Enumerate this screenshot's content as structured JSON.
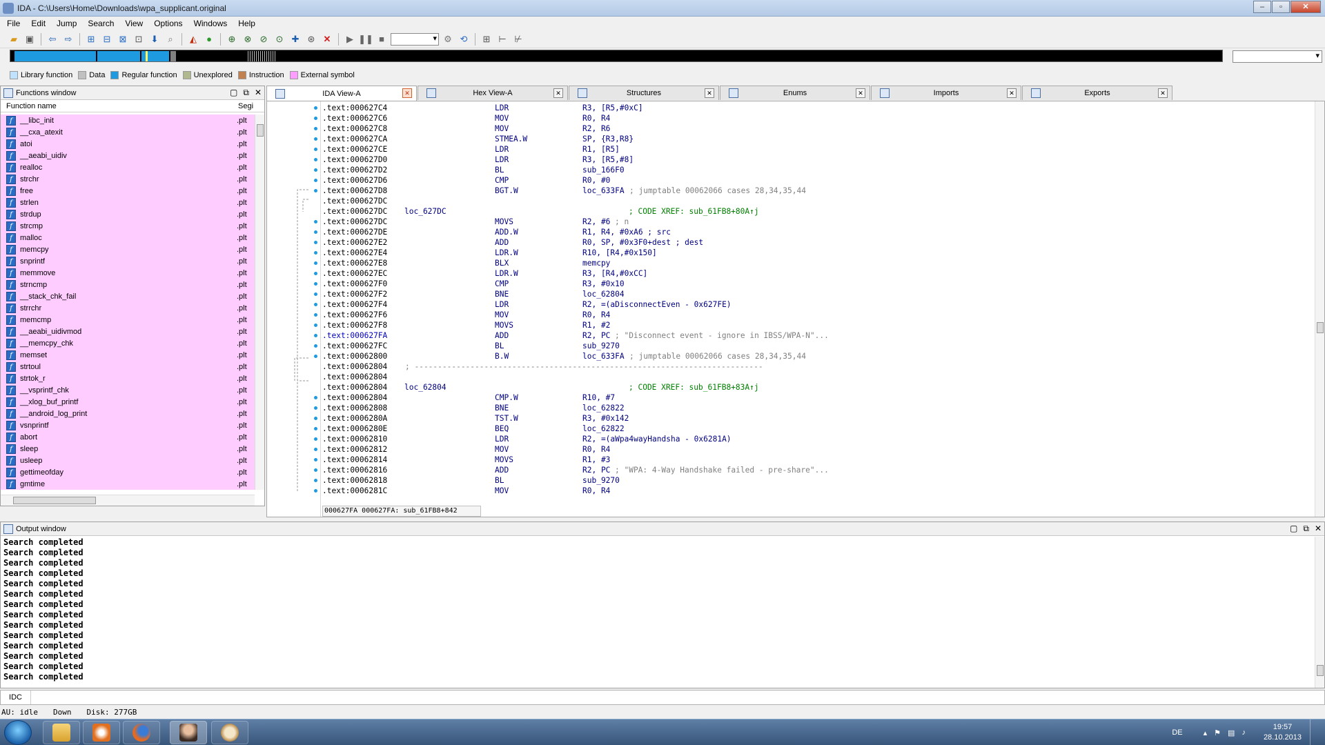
{
  "window": {
    "title": "IDA - C:\\Users\\Home\\Downloads\\wpa_supplicant.original"
  },
  "menu": [
    "File",
    "Edit",
    "Jump",
    "Search",
    "View",
    "Options",
    "Windows",
    "Help"
  ],
  "legend": [
    {
      "label": "Library function",
      "color": "#bfe3ff"
    },
    {
      "label": "Data",
      "color": "#c0c0c0"
    },
    {
      "label": "Regular function",
      "color": "#1e9be0"
    },
    {
      "label": "Unexplored",
      "color": "#b0b890"
    },
    {
      "label": "Instruction",
      "color": "#c08050"
    },
    {
      "label": "External symbol",
      "color": "#ff9cff"
    }
  ],
  "functions_window": {
    "title": "Functions window",
    "col_name": "Function name",
    "col_seg": "Segi",
    "items": [
      {
        "name": "__libc_init",
        "seg": ".plt"
      },
      {
        "name": "__cxa_atexit",
        "seg": ".plt"
      },
      {
        "name": "atoi",
        "seg": ".plt"
      },
      {
        "name": "__aeabi_uidiv",
        "seg": ".plt"
      },
      {
        "name": "realloc",
        "seg": ".plt"
      },
      {
        "name": "strchr",
        "seg": ".plt"
      },
      {
        "name": "free",
        "seg": ".plt"
      },
      {
        "name": "strlen",
        "seg": ".plt"
      },
      {
        "name": "strdup",
        "seg": ".plt"
      },
      {
        "name": "strcmp",
        "seg": ".plt"
      },
      {
        "name": "malloc",
        "seg": ".plt"
      },
      {
        "name": "memcpy",
        "seg": ".plt"
      },
      {
        "name": "snprintf",
        "seg": ".plt"
      },
      {
        "name": "memmove",
        "seg": ".plt"
      },
      {
        "name": "strncmp",
        "seg": ".plt"
      },
      {
        "name": "__stack_chk_fail",
        "seg": ".plt"
      },
      {
        "name": "strrchr",
        "seg": ".plt"
      },
      {
        "name": "memcmp",
        "seg": ".plt"
      },
      {
        "name": "__aeabi_uidivmod",
        "seg": ".plt"
      },
      {
        "name": "__memcpy_chk",
        "seg": ".plt"
      },
      {
        "name": "memset",
        "seg": ".plt"
      },
      {
        "name": "strtoul",
        "seg": ".plt"
      },
      {
        "name": "strtok_r",
        "seg": ".plt"
      },
      {
        "name": "__vsprintf_chk",
        "seg": ".plt"
      },
      {
        "name": "__xlog_buf_printf",
        "seg": ".plt"
      },
      {
        "name": "__android_log_print",
        "seg": ".plt"
      },
      {
        "name": "vsnprintf",
        "seg": ".plt"
      },
      {
        "name": "abort",
        "seg": ".plt"
      },
      {
        "name": "sleep",
        "seg": ".plt"
      },
      {
        "name": "usleep",
        "seg": ".plt"
      },
      {
        "name": "gettimeofday",
        "seg": ".plt"
      },
      {
        "name": "gmtime",
        "seg": ".plt"
      }
    ]
  },
  "tabs": [
    {
      "label": "IDA View-A",
      "active": true
    },
    {
      "label": "Hex View-A",
      "active": false
    },
    {
      "label": "Structures",
      "active": false
    },
    {
      "label": "Enums",
      "active": false
    },
    {
      "label": "Imports",
      "active": false
    },
    {
      "label": "Exports",
      "active": false
    }
  ],
  "disasm": {
    "lines": [
      {
        "addr": ".text:000627C4",
        "lbl": "",
        "mn": "LDR",
        "op": "R3, [R5,#0xC]",
        "cm": "",
        "xr": "",
        "dot": true
      },
      {
        "addr": ".text:000627C6",
        "lbl": "",
        "mn": "MOV",
        "op": "R0, R4",
        "cm": "",
        "xr": "",
        "dot": true
      },
      {
        "addr": ".text:000627C8",
        "lbl": "",
        "mn": "MOV",
        "op": "R2, R6",
        "cm": "",
        "xr": "",
        "dot": true
      },
      {
        "addr": ".text:000627CA",
        "lbl": "",
        "mn": "STMEA.W",
        "op": "SP, {R3,R8}",
        "cm": "",
        "xr": "",
        "dot": true
      },
      {
        "addr": ".text:000627CE",
        "lbl": "",
        "mn": "LDR",
        "op": "R1, [R5]",
        "cm": "",
        "xr": "",
        "dot": true
      },
      {
        "addr": ".text:000627D0",
        "lbl": "",
        "mn": "LDR",
        "op": "R3, [R5,#8]",
        "cm": "",
        "xr": "",
        "dot": true
      },
      {
        "addr": ".text:000627D2",
        "lbl": "",
        "mn": "BL",
        "op": "sub_166F0",
        "cm": "",
        "xr": "",
        "dot": true
      },
      {
        "addr": ".text:000627D6",
        "lbl": "",
        "mn": "CMP",
        "op": "R0, #0",
        "cm": "",
        "xr": "",
        "dot": true
      },
      {
        "addr": ".text:000627D8",
        "lbl": "",
        "mn": "BGT.W",
        "op": "loc_633FA",
        "cm": "; jumptable 00062066 cases 28,34,35,44",
        "xr": "",
        "dot": true
      },
      {
        "addr": ".text:000627DC",
        "lbl": "",
        "mn": "",
        "op": "",
        "cm": "",
        "xr": "",
        "dot": false
      },
      {
        "addr": ".text:000627DC",
        "lbl": "loc_627DC",
        "mn": "",
        "op": "",
        "cm": "",
        "xr": "; CODE XREF: sub_61FB8+80A↑j",
        "dot": false
      },
      {
        "addr": ".text:000627DC",
        "lbl": "",
        "mn": "MOVS",
        "op": "R2, #6",
        "cm": "; n",
        "xr": "",
        "dot": true
      },
      {
        "addr": ".text:000627DE",
        "lbl": "",
        "mn": "ADD.W",
        "op": "R1, R4, #0xA6 ; src",
        "cm": "",
        "xr": "",
        "dot": true
      },
      {
        "addr": ".text:000627E2",
        "lbl": "",
        "mn": "ADD",
        "op": "R0, SP, #0x3F0+dest ; dest",
        "cm": "",
        "xr": "",
        "dot": true
      },
      {
        "addr": ".text:000627E4",
        "lbl": "",
        "mn": "LDR.W",
        "op": "R10, [R4,#0x150]",
        "cm": "",
        "xr": "",
        "dot": true
      },
      {
        "addr": ".text:000627E8",
        "lbl": "",
        "mn": "BLX",
        "op": "memcpy",
        "cm": "",
        "xr": "",
        "dot": true
      },
      {
        "addr": ".text:000627EC",
        "lbl": "",
        "mn": "LDR.W",
        "op": "R3, [R4,#0xCC]",
        "cm": "",
        "xr": "",
        "dot": true
      },
      {
        "addr": ".text:000627F0",
        "lbl": "",
        "mn": "CMP",
        "op": "R3, #0x10",
        "cm": "",
        "xr": "",
        "dot": true
      },
      {
        "addr": ".text:000627F2",
        "lbl": "",
        "mn": "BNE",
        "op": "loc_62804",
        "cm": "",
        "xr": "",
        "dot": true
      },
      {
        "addr": ".text:000627F4",
        "lbl": "",
        "mn": "LDR",
        "op": "R2, =(aDisconnectEven - 0x627FE)",
        "cm": "",
        "xr": "",
        "dot": true
      },
      {
        "addr": ".text:000627F6",
        "lbl": "",
        "mn": "MOV",
        "op": "R0, R4",
        "cm": "",
        "xr": "",
        "dot": true
      },
      {
        "addr": ".text:000627F8",
        "lbl": "",
        "mn": "MOVS",
        "op": "R1, #2",
        "cm": "",
        "xr": "",
        "dot": true
      },
      {
        "addr": ".text:000627FA",
        "lbl": "",
        "mn": "ADD",
        "op": "R2, PC",
        "cm": "; \"Disconnect event - ignore in IBSS/WPA-N\"...",
        "xr": "",
        "dot": true,
        "hl": true
      },
      {
        "addr": ".text:000627FC",
        "lbl": "",
        "mn": "BL",
        "op": "sub_9270",
        "cm": "",
        "xr": "",
        "dot": true
      },
      {
        "addr": ".text:00062800",
        "lbl": "",
        "mn": "B.W",
        "op": "loc_633FA",
        "cm": "; jumptable 00062066 cases 28,34,35,44",
        "xr": "",
        "dot": true
      },
      {
        "addr": ".text:00062804",
        "lbl": "",
        "mn": "",
        "op": "",
        "cm": "",
        "xr": "",
        "dot": false,
        "sep": "; ---------------------------------------------------------------------------"
      },
      {
        "addr": ".text:00062804",
        "lbl": "",
        "mn": "",
        "op": "",
        "cm": "",
        "xr": "",
        "dot": false
      },
      {
        "addr": ".text:00062804",
        "lbl": "loc_62804",
        "mn": "",
        "op": "",
        "cm": "",
        "xr": "; CODE XREF: sub_61FB8+83A↑j",
        "dot": false
      },
      {
        "addr": ".text:00062804",
        "lbl": "",
        "mn": "CMP.W",
        "op": "R10, #7",
        "cm": "",
        "xr": "",
        "dot": true
      },
      {
        "addr": ".text:00062808",
        "lbl": "",
        "mn": "BNE",
        "op": "loc_62822",
        "cm": "",
        "xr": "",
        "dot": true
      },
      {
        "addr": ".text:0006280A",
        "lbl": "",
        "mn": "TST.W",
        "op": "R3, #0x142",
        "cm": "",
        "xr": "",
        "dot": true
      },
      {
        "addr": ".text:0006280E",
        "lbl": "",
        "mn": "BEQ",
        "op": "loc_62822",
        "cm": "",
        "xr": "",
        "dot": true
      },
      {
        "addr": ".text:00062810",
        "lbl": "",
        "mn": "LDR",
        "op": "R2, =(aWpa4wayHandsha - 0x6281A)",
        "cm": "",
        "xr": "",
        "dot": true
      },
      {
        "addr": ".text:00062812",
        "lbl": "",
        "mn": "MOV",
        "op": "R0, R4",
        "cm": "",
        "xr": "",
        "dot": true
      },
      {
        "addr": ".text:00062814",
        "lbl": "",
        "mn": "MOVS",
        "op": "R1, #3",
        "cm": "",
        "xr": "",
        "dot": true
      },
      {
        "addr": ".text:00062816",
        "lbl": "",
        "mn": "ADD",
        "op": "R2, PC",
        "cm": "; \"WPA: 4-Way Handshake failed - pre-share\"...",
        "xr": "",
        "dot": true
      },
      {
        "addr": ".text:00062818",
        "lbl": "",
        "mn": "BL",
        "op": "sub_9270",
        "cm": "",
        "xr": "",
        "dot": true
      },
      {
        "addr": ".text:0006281C",
        "lbl": "",
        "mn": "MOV",
        "op": "R0, R4",
        "cm": "",
        "xr": "",
        "dot": true
      }
    ],
    "status": "000627FA 000627FA: sub_61FB8+842"
  },
  "output_window": {
    "title": "Output window",
    "lines": [
      "Search completed",
      "Search completed",
      "Search completed",
      "Search completed",
      "Search completed",
      "Search completed",
      "Search completed",
      "Search completed",
      "Search completed",
      "Search completed",
      "Search completed",
      "Search completed",
      "Search completed",
      "Search completed"
    ]
  },
  "idc": {
    "label": "IDC"
  },
  "status": {
    "au": "AU:  idle",
    "dir": "Down",
    "disk": "Disk: 277GB"
  },
  "taskbar": {
    "lang": "DE",
    "time": "19:57",
    "date": "28.10.2013"
  }
}
